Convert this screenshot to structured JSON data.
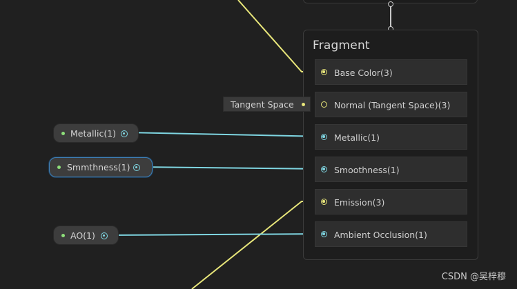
{
  "colors": {
    "background": "#202020",
    "vector_wire": "#e8e67a",
    "float_wire": "#7fd6e2",
    "property_dot": "#8ee07a",
    "selection": "#3f7fb5"
  },
  "fragment": {
    "title": "Fragment",
    "slots": [
      {
        "label": "Base Color(3)",
        "port_type": "vector3",
        "port_icon": "port-filled-icon"
      },
      {
        "label": "Normal (Tangent Space)(3)",
        "port_type": "vector3",
        "port_icon": "port-hollow-icon"
      },
      {
        "label": "Metallic(1)",
        "port_type": "float",
        "port_icon": "port-filled-icon"
      },
      {
        "label": "Smoothness(1)",
        "port_type": "float",
        "port_icon": "port-filled-icon"
      },
      {
        "label": "Emission(3)",
        "port_type": "vector3",
        "port_icon": "port-filled-icon"
      },
      {
        "label": "Ambient Occlusion(1)",
        "port_type": "float",
        "port_icon": "port-filled-icon"
      }
    ]
  },
  "properties": [
    {
      "label": "Metallic(1)",
      "selected": false
    },
    {
      "label": "Smmthness(1)",
      "selected": true
    },
    {
      "label": "AO(1)",
      "selected": false
    }
  ],
  "tangent_space": {
    "label": "Tangent Space"
  },
  "watermark": {
    "text": "CSDN @吴梓穆"
  }
}
